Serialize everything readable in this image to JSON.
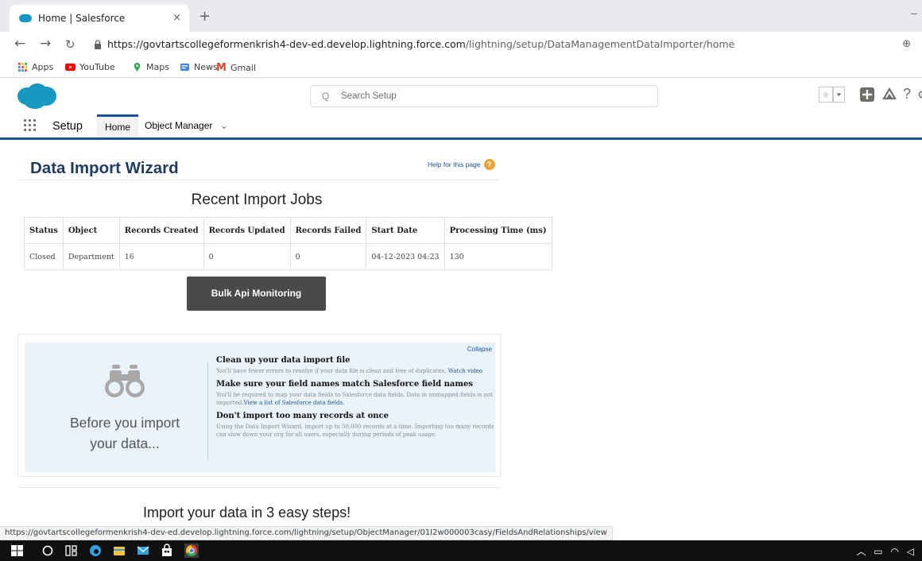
{
  "browser": {
    "tab_title": "Home | Salesforce",
    "tab_close": "×",
    "new_tab": "+",
    "window_min": "–",
    "url_host": "https://govtartscollegeformenkrish4-dev-ed.develop.lightning.force.com",
    "url_path": "/lightning/setup/DataManagementDataImporter/home",
    "bookmarks": [
      "Apps",
      "YouTube",
      "Maps",
      "News",
      "Gmail"
    ]
  },
  "sf_header": {
    "search_placeholder": "Search Setup"
  },
  "app_nav": {
    "app_name": "Setup",
    "tabs": [
      "Home",
      "Object Manager"
    ]
  },
  "page": {
    "title": "Data Import Wizard",
    "help_link": "Help for this page"
  },
  "jobs": {
    "title": "Recent Import Jobs",
    "columns": [
      "Status",
      "Object",
      "Records Created",
      "Records Updated",
      "Records Failed",
      "Start Date",
      "Processing Time (ms)"
    ],
    "rows": [
      [
        "Closed",
        "Department",
        "16",
        "0",
        "0",
        "04-12-2023 04:23",
        "130"
      ]
    ]
  },
  "bulk_button": "Bulk Api Monitoring",
  "info": {
    "collapse": "Collapse",
    "before_line1": "Before you import",
    "before_line2": "your data...",
    "steps": [
      {
        "heading": "Clean up your data import file",
        "text": "You'll have fewer errors to resolve if your data file is clean and free of duplicates.",
        "link": "Watch video"
      },
      {
        "heading": "Make sure your field names match Salesforce field names",
        "text": "You'll be required to map your data fields to Salesforce data fields. Data in unmapped fields is not imported.",
        "link": "View a list of Salesforce data fields."
      },
      {
        "heading": "Don't import too many records at once",
        "text": "Using the Data Import Wizard, import up to 50,000 records at a time. Importing too many records can slow down your org for all users, especially during periods of peak usage.",
        "link": ""
      }
    ]
  },
  "import_steps_title": "Import your data in 3 easy steps!",
  "status_url": "https://govtartscollegeformenkrish4-dev-ed.develop.lightning.force.com/lightning/setup/ObjectManager/01I2w000003casy/FieldsAndRelationships/view",
  "colors": {
    "brand_blue": "#1798c1",
    "nav_accent": "#1b5297",
    "button_dark": "#4a4a4a",
    "panel_bg": "#e9f3fb"
  }
}
